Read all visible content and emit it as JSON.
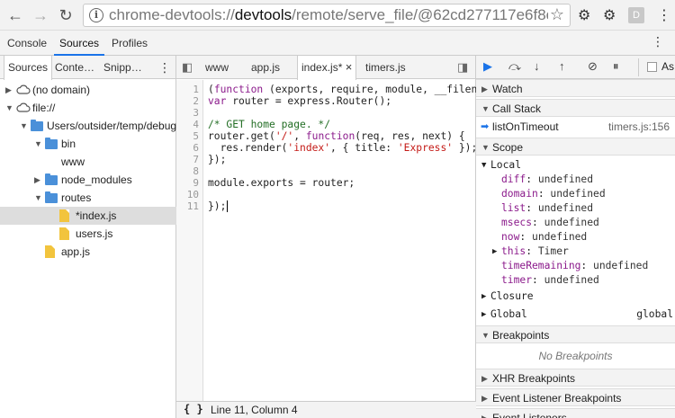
{
  "browser": {
    "url_prefix": "chrome-devtools://",
    "url_host": "devtools",
    "url_rest": "/remote/serve_file/@62cd277117e6f8ec53e3…",
    "avatar_letter": "D"
  },
  "devtools_tabs": [
    "Console",
    "Sources",
    "Profiles"
  ],
  "navigator": {
    "tabs": [
      "Sources",
      "Conte…",
      "Snipp…"
    ],
    "tree": [
      {
        "label": "(no domain)",
        "kind": "cloud",
        "expanded": false,
        "depth": 0
      },
      {
        "label": "file://",
        "kind": "cloud",
        "expanded": true,
        "depth": 0
      },
      {
        "label": "Users/outsider/temp/debug",
        "kind": "folder",
        "expanded": true,
        "depth": 1
      },
      {
        "label": "bin",
        "kind": "folder",
        "expanded": true,
        "depth": 2
      },
      {
        "label": "www",
        "kind": "file-plain",
        "depth": 3
      },
      {
        "label": "node_modules",
        "kind": "folder",
        "expanded": false,
        "depth": 2
      },
      {
        "label": "routes",
        "kind": "folder",
        "expanded": true,
        "depth": 2
      },
      {
        "label": "*index.js",
        "kind": "file",
        "depth": 3,
        "selected": true
      },
      {
        "label": "users.js",
        "kind": "file",
        "depth": 3
      },
      {
        "label": "app.js",
        "kind": "file",
        "depth": 2
      }
    ]
  },
  "editor": {
    "tabs": [
      "www",
      "app.js",
      "index.js*",
      "timers.js"
    ],
    "close_glyph": "×",
    "line_numbers": [
      "1",
      "2",
      "3",
      "4",
      "5",
      "6",
      "7",
      "8",
      "9",
      "10",
      "11"
    ],
    "status": "Line 11, Column 4",
    "format_glyph": "{ }"
  },
  "debugger": {
    "watch_label": "Watch",
    "callstack_label": "Call Stack",
    "frame_name": "listOnTimeout",
    "frame_loc": "timers.js:156",
    "scope_label": "Scope",
    "local_label": "Local",
    "vars": [
      {
        "name": "diff",
        "value": "undefined"
      },
      {
        "name": "domain",
        "value": "undefined"
      },
      {
        "name": "list",
        "value": "undefined"
      },
      {
        "name": "msecs",
        "value": "undefined"
      },
      {
        "name": "now",
        "value": "undefined"
      },
      {
        "name": "this",
        "value": "Timer",
        "expandable": true
      },
      {
        "name": "timeRemaining",
        "value": "undefined"
      },
      {
        "name": "timer",
        "value": "undefined"
      }
    ],
    "closure_label": "Closure",
    "global_label": "Global",
    "global_value": "global",
    "breakpoints_label": "Breakpoints",
    "no_breakpoints": "No Breakpoints",
    "xhr_label": "XHR Breakpoints",
    "event_listener_bp_label": "Event Listener Breakpoints",
    "event_listeners_label": "Event Listeners",
    "async_label": "As"
  },
  "colors": {
    "accent": "#1a73e8",
    "folder": "#4a90d9",
    "file": "#f2c43d",
    "keyword": "#8b1a8b",
    "string": "#c41a16",
    "comment": "#236e25"
  }
}
